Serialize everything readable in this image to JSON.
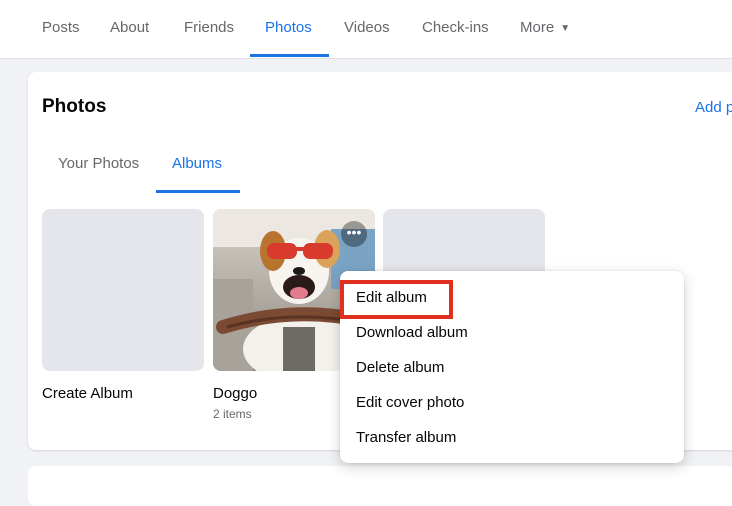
{
  "nav": {
    "tabs": [
      {
        "label": "Posts"
      },
      {
        "label": "About"
      },
      {
        "label": "Friends"
      },
      {
        "label": "Photos"
      },
      {
        "label": "Videos"
      },
      {
        "label": "Check-ins"
      },
      {
        "label": "More"
      }
    ],
    "active": "Photos"
  },
  "photos": {
    "title": "Photos",
    "add_link": "Add p",
    "subtabs": [
      {
        "label": "Your Photos"
      },
      {
        "label": "Albums"
      }
    ],
    "active_subtab": "Albums",
    "albums": [
      {
        "label": "Create Album",
        "count": ""
      },
      {
        "label": "Doggo",
        "count": "2 items"
      },
      {
        "label": "",
        "count": ""
      }
    ]
  },
  "album_menu": {
    "items": [
      {
        "label": "Edit album"
      },
      {
        "label": "Download album"
      },
      {
        "label": "Delete album"
      },
      {
        "label": "Edit cover photo"
      },
      {
        "label": "Transfer album"
      }
    ],
    "highlighted_item": "Edit album"
  },
  "colors": {
    "accent": "#1b74e4",
    "highlight_box": "#e0301e",
    "muted_text": "#65676b"
  }
}
